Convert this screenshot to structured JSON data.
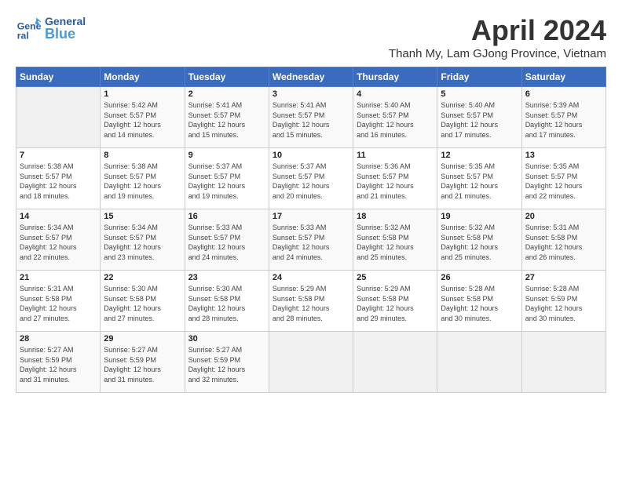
{
  "header": {
    "logo_general": "General",
    "logo_blue": "Blue",
    "title": "April 2024",
    "subtitle": "Thanh My, Lam GJong Province, Vietnam"
  },
  "calendar": {
    "days_of_week": [
      "Sunday",
      "Monday",
      "Tuesday",
      "Wednesday",
      "Thursday",
      "Friday",
      "Saturday"
    ],
    "weeks": [
      [
        {
          "day": "",
          "info": ""
        },
        {
          "day": "1",
          "info": "Sunrise: 5:42 AM\nSunset: 5:57 PM\nDaylight: 12 hours\nand 14 minutes."
        },
        {
          "day": "2",
          "info": "Sunrise: 5:41 AM\nSunset: 5:57 PM\nDaylight: 12 hours\nand 15 minutes."
        },
        {
          "day": "3",
          "info": "Sunrise: 5:41 AM\nSunset: 5:57 PM\nDaylight: 12 hours\nand 15 minutes."
        },
        {
          "day": "4",
          "info": "Sunrise: 5:40 AM\nSunset: 5:57 PM\nDaylight: 12 hours\nand 16 minutes."
        },
        {
          "day": "5",
          "info": "Sunrise: 5:40 AM\nSunset: 5:57 PM\nDaylight: 12 hours\nand 17 minutes."
        },
        {
          "day": "6",
          "info": "Sunrise: 5:39 AM\nSunset: 5:57 PM\nDaylight: 12 hours\nand 17 minutes."
        }
      ],
      [
        {
          "day": "7",
          "info": "Sunrise: 5:38 AM\nSunset: 5:57 PM\nDaylight: 12 hours\nand 18 minutes."
        },
        {
          "day": "8",
          "info": "Sunrise: 5:38 AM\nSunset: 5:57 PM\nDaylight: 12 hours\nand 19 minutes."
        },
        {
          "day": "9",
          "info": "Sunrise: 5:37 AM\nSunset: 5:57 PM\nDaylight: 12 hours\nand 19 minutes."
        },
        {
          "day": "10",
          "info": "Sunrise: 5:37 AM\nSunset: 5:57 PM\nDaylight: 12 hours\nand 20 minutes."
        },
        {
          "day": "11",
          "info": "Sunrise: 5:36 AM\nSunset: 5:57 PM\nDaylight: 12 hours\nand 21 minutes."
        },
        {
          "day": "12",
          "info": "Sunrise: 5:35 AM\nSunset: 5:57 PM\nDaylight: 12 hours\nand 21 minutes."
        },
        {
          "day": "13",
          "info": "Sunrise: 5:35 AM\nSunset: 5:57 PM\nDaylight: 12 hours\nand 22 minutes."
        }
      ],
      [
        {
          "day": "14",
          "info": "Sunrise: 5:34 AM\nSunset: 5:57 PM\nDaylight: 12 hours\nand 22 minutes."
        },
        {
          "day": "15",
          "info": "Sunrise: 5:34 AM\nSunset: 5:57 PM\nDaylight: 12 hours\nand 23 minutes."
        },
        {
          "day": "16",
          "info": "Sunrise: 5:33 AM\nSunset: 5:57 PM\nDaylight: 12 hours\nand 24 minutes."
        },
        {
          "day": "17",
          "info": "Sunrise: 5:33 AM\nSunset: 5:57 PM\nDaylight: 12 hours\nand 24 minutes."
        },
        {
          "day": "18",
          "info": "Sunrise: 5:32 AM\nSunset: 5:58 PM\nDaylight: 12 hours\nand 25 minutes."
        },
        {
          "day": "19",
          "info": "Sunrise: 5:32 AM\nSunset: 5:58 PM\nDaylight: 12 hours\nand 25 minutes."
        },
        {
          "day": "20",
          "info": "Sunrise: 5:31 AM\nSunset: 5:58 PM\nDaylight: 12 hours\nand 26 minutes."
        }
      ],
      [
        {
          "day": "21",
          "info": "Sunrise: 5:31 AM\nSunset: 5:58 PM\nDaylight: 12 hours\nand 27 minutes."
        },
        {
          "day": "22",
          "info": "Sunrise: 5:30 AM\nSunset: 5:58 PM\nDaylight: 12 hours\nand 27 minutes."
        },
        {
          "day": "23",
          "info": "Sunrise: 5:30 AM\nSunset: 5:58 PM\nDaylight: 12 hours\nand 28 minutes."
        },
        {
          "day": "24",
          "info": "Sunrise: 5:29 AM\nSunset: 5:58 PM\nDaylight: 12 hours\nand 28 minutes."
        },
        {
          "day": "25",
          "info": "Sunrise: 5:29 AM\nSunset: 5:58 PM\nDaylight: 12 hours\nand 29 minutes."
        },
        {
          "day": "26",
          "info": "Sunrise: 5:28 AM\nSunset: 5:58 PM\nDaylight: 12 hours\nand 30 minutes."
        },
        {
          "day": "27",
          "info": "Sunrise: 5:28 AM\nSunset: 5:59 PM\nDaylight: 12 hours\nand 30 minutes."
        }
      ],
      [
        {
          "day": "28",
          "info": "Sunrise: 5:27 AM\nSunset: 5:59 PM\nDaylight: 12 hours\nand 31 minutes."
        },
        {
          "day": "29",
          "info": "Sunrise: 5:27 AM\nSunset: 5:59 PM\nDaylight: 12 hours\nand 31 minutes."
        },
        {
          "day": "30",
          "info": "Sunrise: 5:27 AM\nSunset: 5:59 PM\nDaylight: 12 hours\nand 32 minutes."
        },
        {
          "day": "",
          "info": ""
        },
        {
          "day": "",
          "info": ""
        },
        {
          "day": "",
          "info": ""
        },
        {
          "day": "",
          "info": ""
        }
      ]
    ]
  }
}
